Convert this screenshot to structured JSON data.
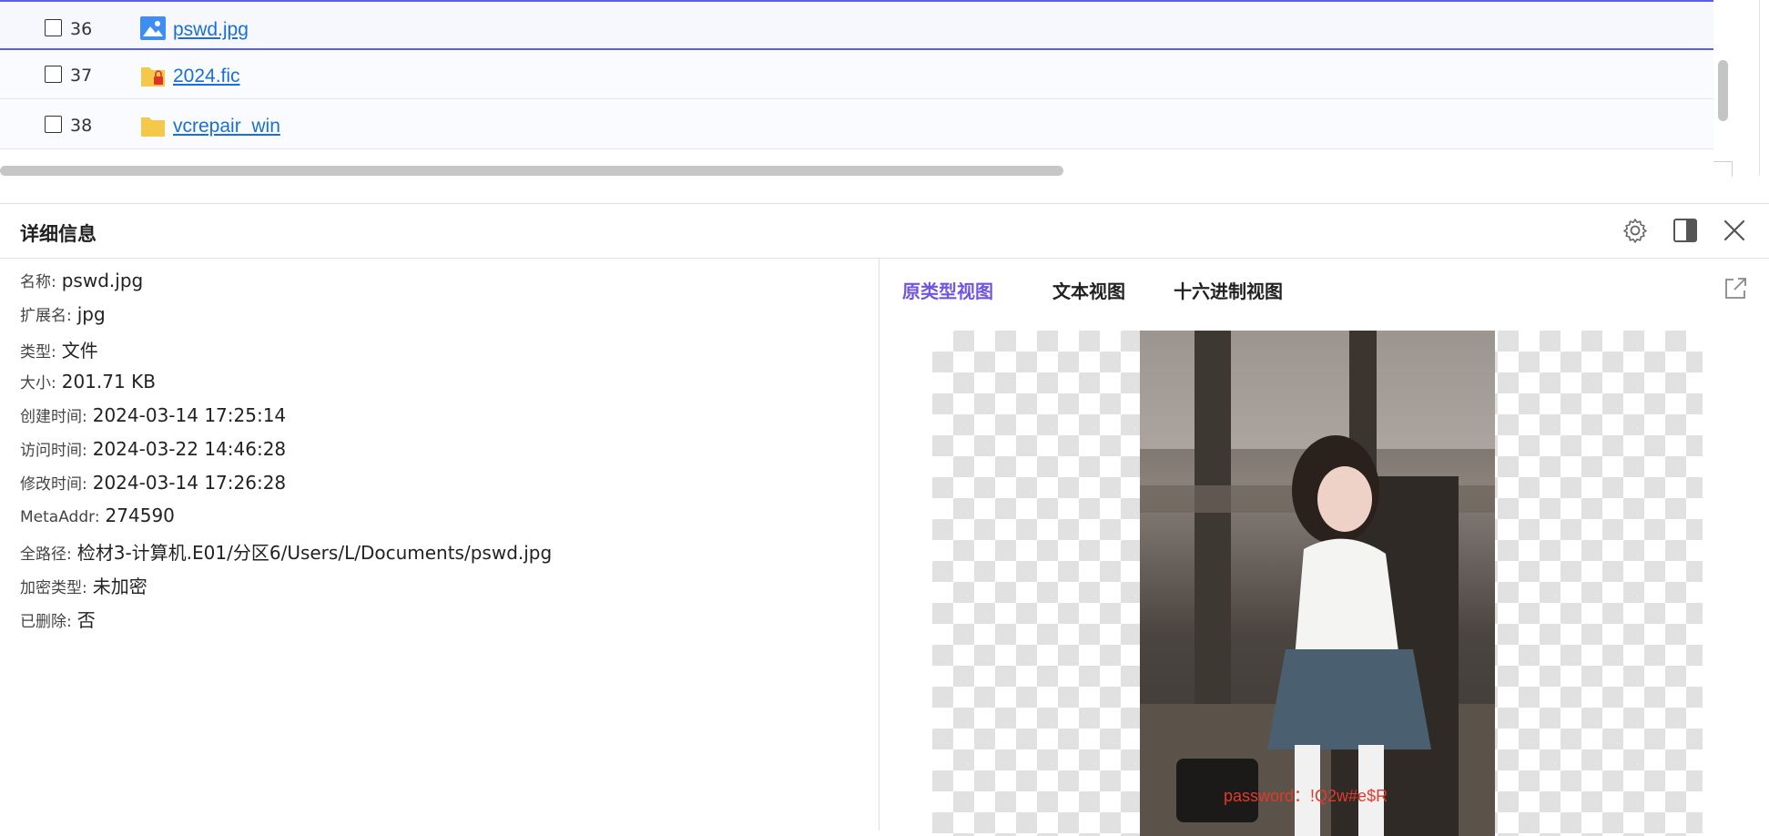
{
  "file_list": {
    "rows": [
      {
        "num": "36",
        "name": "pswd.jpg",
        "icon": "image-file-icon",
        "selected": true
      },
      {
        "num": "37",
        "name": "2024.fic",
        "icon": "locked-folder-icon",
        "selected": false
      },
      {
        "num": "38",
        "name": "vcrepair_win",
        "icon": "folder-icon",
        "selected": false
      }
    ]
  },
  "details": {
    "title": "详细信息",
    "fields": [
      {
        "label": "名称:",
        "value": "pswd.jpg"
      },
      {
        "label": "扩展名:",
        "value": "jpg"
      },
      {
        "label": "类型:",
        "value": "文件"
      },
      {
        "label": "大小:",
        "value": "201.71 KB"
      },
      {
        "label": "创建时间:",
        "value": "2024-03-14 17:25:14"
      },
      {
        "label": "访问时间:",
        "value": "2024-03-22 14:46:28"
      },
      {
        "label": "修改时间:",
        "value": "2024-03-14 17:26:28"
      },
      {
        "label": "MetaAddr:",
        "value": "274590"
      },
      {
        "label": "全路径:",
        "value": "检材3-计算机.E01/分区6/Users/L/Documents/pswd.jpg"
      },
      {
        "label": "加密类型:",
        "value": "未加密"
      },
      {
        "label": "已删除:",
        "value": "否"
      }
    ]
  },
  "preview": {
    "tabs": [
      "原类型视图",
      "文本视图",
      "十六进制视图"
    ],
    "active_tab": "原类型视图",
    "watermark_text": "password：!Q2w#e$R"
  },
  "colors": {
    "accent": "#6f55e2",
    "link": "#1a6fd6",
    "selection_border": "#5b5fe6",
    "watermark": "#e23a2c"
  }
}
